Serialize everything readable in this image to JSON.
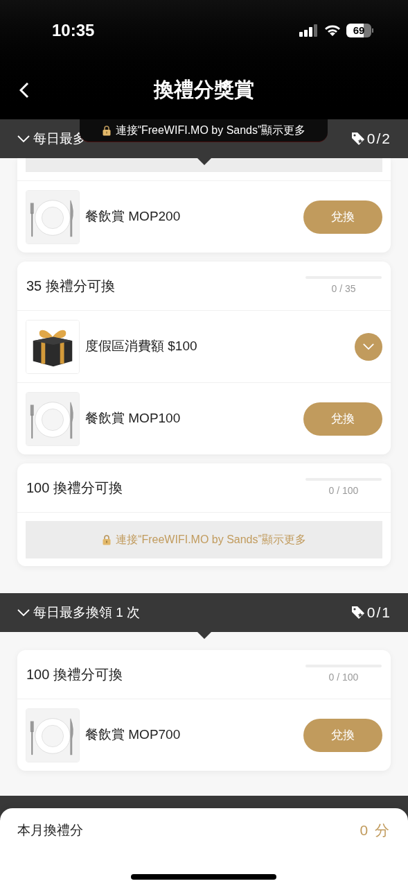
{
  "status_bar": {
    "time": "10:35",
    "battery": "69"
  },
  "nav": {
    "title": "換禮分獎賞"
  },
  "toast": {
    "text": "連接“FreeWIFI.MO by Sands”顯示更多"
  },
  "sections": [
    {
      "label": "每日最多",
      "count": "0/2",
      "expanded": true,
      "groups": [
        {
          "items": [
            {
              "kind": "redeem",
              "name": "餐飲賞 MOP200",
              "action": "兌換"
            }
          ]
        },
        {
          "title": "35 換禮分可換",
          "progress": {
            "level": 0,
            "reading": "0 / 35"
          },
          "items": [
            {
              "kind": "expandable",
              "name": "度假區消費額 $100",
              "expanded": false
            },
            {
              "kind": "redeem",
              "name": "餐飲賞 MOP100",
              "action": "兌換"
            }
          ]
        },
        {
          "title": "100 換禮分可換",
          "progress": {
            "level": 0,
            "reading": "0 / 100"
          },
          "locked_hint": "連接“FreeWIFI.MO by Sands”顯示更多"
        }
      ]
    },
    {
      "label": "每日最多換領 1 次",
      "count": "0/1",
      "expanded": true,
      "groups": [
        {
          "title": "100 換禮分可換",
          "progress": {
            "level": 0,
            "reading": "0 / 100"
          },
          "items": [
            {
              "kind": "redeem",
              "name": "餐飲賞 MOP700",
              "action": "兌換"
            }
          ]
        }
      ]
    }
  ],
  "footer": {
    "label": "本月換禮分",
    "value": "0 分"
  }
}
